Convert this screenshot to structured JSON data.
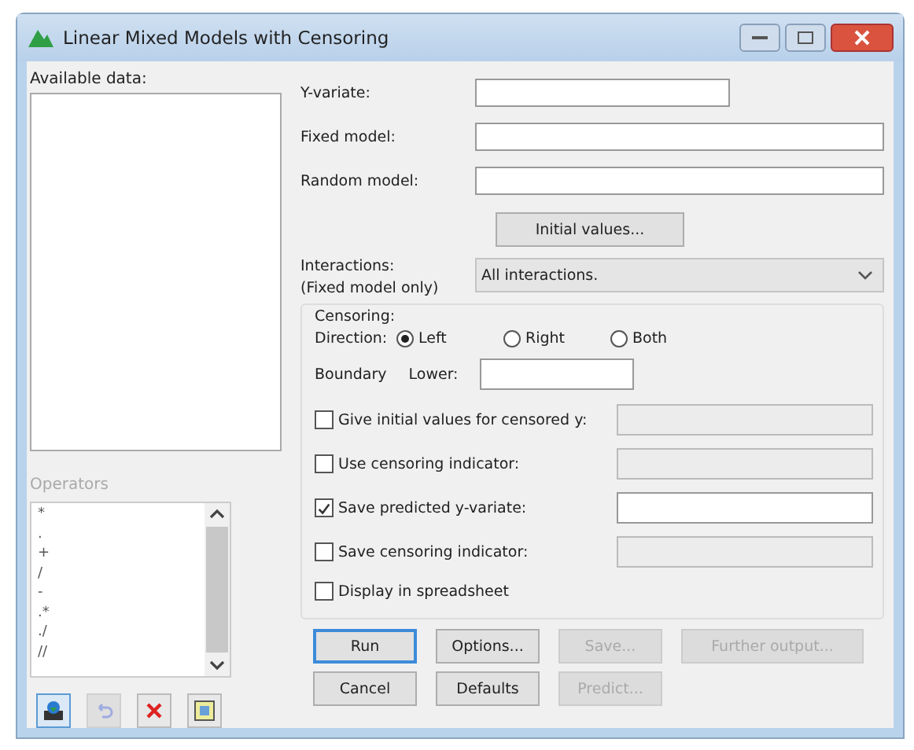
{
  "window": {
    "title": "Linear Mixed Models with Censoring"
  },
  "available_data": {
    "label": "Available data:"
  },
  "operators": {
    "label": "Operators",
    "disabled": true,
    "items": [
      "*",
      ".",
      "+",
      "/",
      "-",
      ".*",
      "./",
      "//"
    ]
  },
  "tool_buttons": [
    {
      "disabled": false
    },
    {
      "disabled": true
    },
    {
      "disabled": false
    },
    {
      "disabled": false
    }
  ],
  "model_fields": [
    {
      "label": "Y-variate:",
      "kind": "short"
    },
    {
      "label": "Fixed model:",
      "kind": "long"
    },
    {
      "label": "Random model:",
      "kind": "long"
    }
  ],
  "initial_values_button": {
    "label": "Initial values..."
  },
  "interactions": {
    "label": "Interactions:",
    "note": "(Fixed model only)",
    "value": "All interactions."
  },
  "censoring": {
    "title": "Censoring:",
    "direction_label": "Direction:",
    "directions": [
      {
        "label": "Left",
        "selected": true
      },
      {
        "label": "Right",
        "selected": false
      },
      {
        "label": "Both",
        "selected": false
      }
    ],
    "boundary_label": "Boundary",
    "lower_label": "Lower:",
    "options": [
      {
        "label": "Give initial values for censored y:",
        "checked": false,
        "has_field": true
      },
      {
        "label": "Use censoring indicator:",
        "checked": false,
        "has_field": true
      },
      {
        "label": "Save predicted y-variate:",
        "checked": true,
        "has_field": true
      },
      {
        "label": "Save censoring indicator:",
        "checked": false,
        "has_field": true
      },
      {
        "label": "Display in spreadsheet",
        "checked": false,
        "has_field": false
      }
    ]
  },
  "buttons": [
    [
      {
        "label": "Run",
        "disabled": false,
        "focused": true
      },
      {
        "label": "Options...",
        "disabled": false,
        "focused": false
      },
      {
        "label": "Save...",
        "disabled": true,
        "focused": false
      },
      {
        "label": "Further output...",
        "disabled": true,
        "focused": false
      }
    ],
    [
      {
        "label": "Cancel",
        "disabled": false,
        "focused": false
      },
      {
        "label": "Defaults",
        "disabled": false,
        "focused": false
      },
      {
        "label": "Predict...",
        "disabled": true,
        "focused": false
      }
    ]
  ]
}
